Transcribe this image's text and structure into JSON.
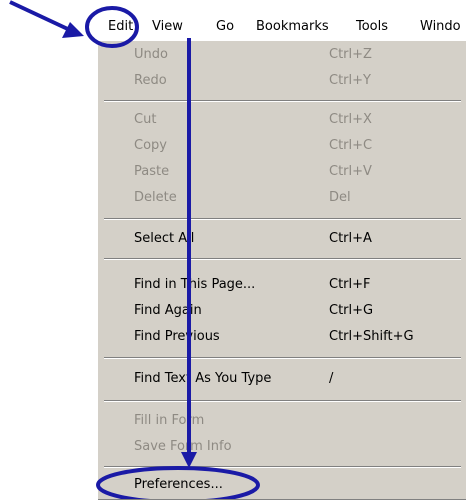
{
  "menubar": {
    "items": [
      {
        "label": "Edit"
      },
      {
        "label": "View"
      },
      {
        "label": "Go"
      },
      {
        "label": "Bookmarks"
      },
      {
        "label": "Tools"
      },
      {
        "label": "Windo"
      }
    ]
  },
  "edit_menu": {
    "items": [
      {
        "label": "Undo",
        "shortcut": "Ctrl+Z"
      },
      {
        "label": "Redo",
        "shortcut": "Ctrl+Y"
      },
      {
        "label": "Cut",
        "shortcut": "Ctrl+X"
      },
      {
        "label": "Copy",
        "shortcut": "Ctrl+C"
      },
      {
        "label": "Paste",
        "shortcut": "Ctrl+V"
      },
      {
        "label": "Delete",
        "shortcut": "Del"
      },
      {
        "label": "Select All",
        "shortcut": "Ctrl+A"
      },
      {
        "label": "Find in This Page...",
        "shortcut": "Ctrl+F"
      },
      {
        "label": "Find Again",
        "shortcut": "Ctrl+G"
      },
      {
        "label": "Find Previous",
        "shortcut": "Ctrl+Shift+G"
      },
      {
        "label": "Find Text As You Type",
        "shortcut": "/"
      },
      {
        "label": "Fill in Form"
      },
      {
        "label": "Save Form Info"
      },
      {
        "label": "Preferences..."
      }
    ]
  },
  "colors": {
    "menu_bg": "#d4d0c8",
    "disabled_text": "#8e8a83",
    "annotation": "#1a1aa6"
  }
}
